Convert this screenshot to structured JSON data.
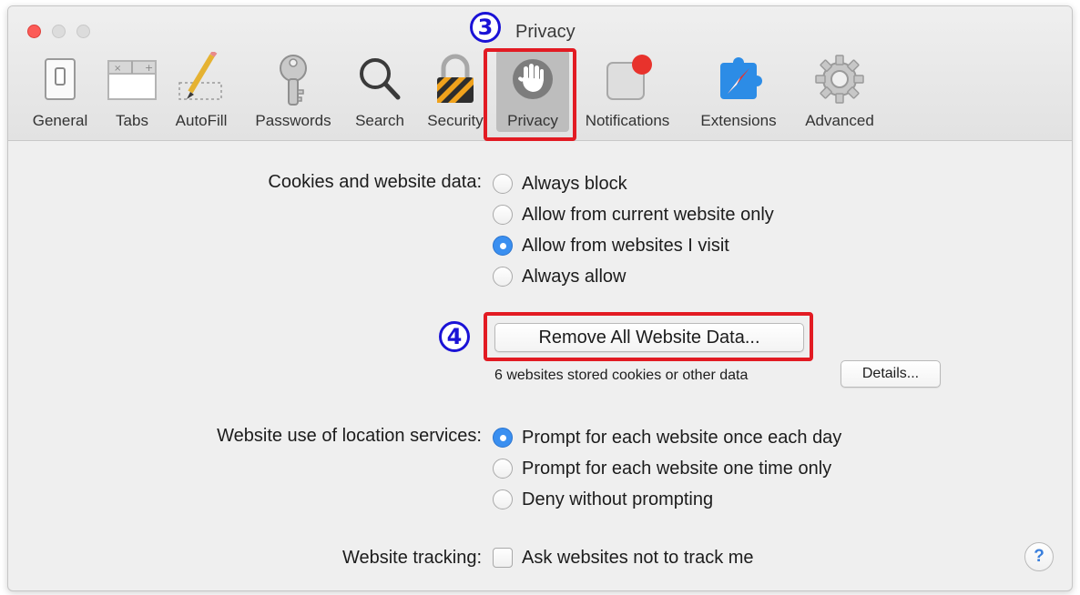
{
  "window": {
    "title": "Privacy"
  },
  "annotations": {
    "step3": "3",
    "step4": "4",
    "highlight_color": "#e21b23",
    "number_color": "#1a12d6"
  },
  "toolbar": {
    "items": [
      {
        "label": "General",
        "icon": "general-switch-icon"
      },
      {
        "label": "Tabs",
        "icon": "tabs-icon"
      },
      {
        "label": "AutoFill",
        "icon": "autofill-pencil-icon"
      },
      {
        "label": "Passwords",
        "icon": "key-icon"
      },
      {
        "label": "Search",
        "icon": "magnifier-icon"
      },
      {
        "label": "Security",
        "icon": "padlock-icon"
      },
      {
        "label": "Privacy",
        "icon": "hand-icon",
        "selected": true
      },
      {
        "label": "Notifications",
        "icon": "notification-badge-icon"
      },
      {
        "label": "Extensions",
        "icon": "puzzle-compass-icon"
      },
      {
        "label": "Advanced",
        "icon": "gear-icon"
      }
    ]
  },
  "cookies": {
    "label": "Cookies and website data:",
    "options": [
      {
        "label": "Always block",
        "selected": false
      },
      {
        "label": "Allow from current website only",
        "selected": false
      },
      {
        "label": "Allow from websites I visit",
        "selected": true
      },
      {
        "label": "Always allow",
        "selected": false
      }
    ],
    "remove_button": "Remove All Website Data...",
    "stored_text": "6 websites stored cookies or other data",
    "details_button": "Details..."
  },
  "location": {
    "label": "Website use of location services:",
    "options": [
      {
        "label": "Prompt for each website once each day",
        "selected": true
      },
      {
        "label": "Prompt for each website one time only",
        "selected": false
      },
      {
        "label": "Deny without prompting",
        "selected": false
      }
    ]
  },
  "tracking": {
    "label": "Website tracking:",
    "checkbox_label": "Ask websites not to track me",
    "checked": false
  },
  "help": {
    "label": "?"
  }
}
